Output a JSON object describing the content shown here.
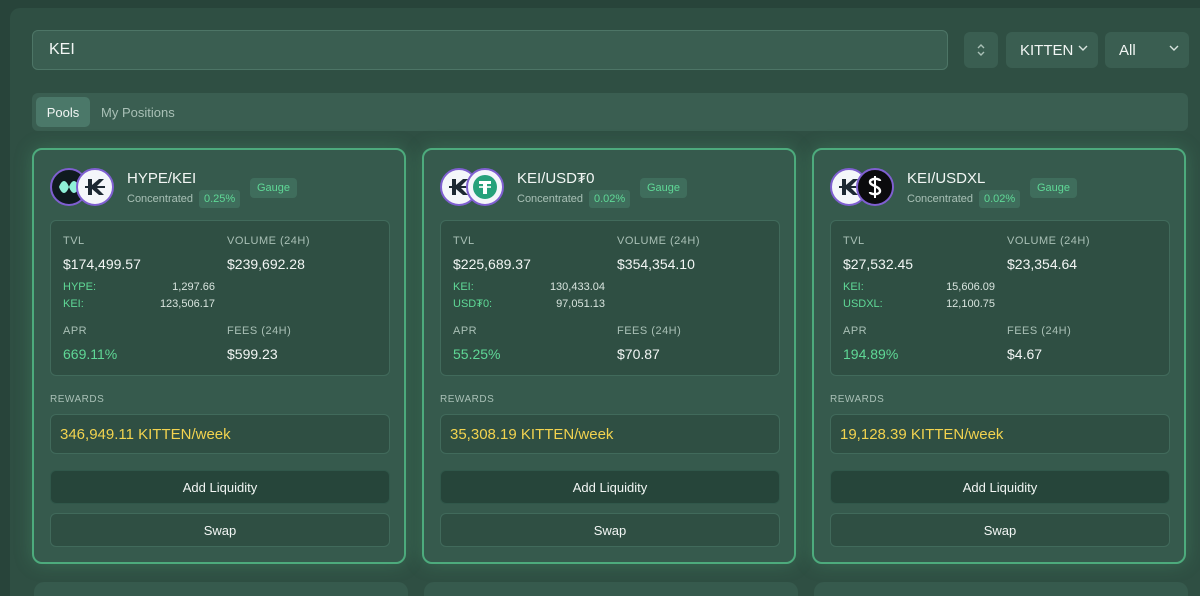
{
  "search": {
    "value": "KEI"
  },
  "filters": {
    "sort_icon": "sort-arrows-icon",
    "token": "KITTEN",
    "category": "All"
  },
  "tabs": [
    {
      "label": "Pools"
    },
    {
      "label": "My Positions"
    }
  ],
  "labels": {
    "tvl": "TVL",
    "volume": "VOLUME (24H)",
    "apr": "APR",
    "fees": "FEES (24H)",
    "rewards": "REWARDS",
    "add_liquidity": "Add Liquidity",
    "swap": "Swap"
  },
  "pools": [
    {
      "name": "HYPE/KEI",
      "type": "Concentrated",
      "fee": "0.25%",
      "gauge": "Gauge",
      "tvl": "$174,499.57",
      "volume": "$239,692.28",
      "token1": "HYPE:",
      "token1_amount": "1,297.66",
      "token2": "KEI:",
      "token2_amount": "123,506.17",
      "apr": "669.11%",
      "fees": "$599.23",
      "rewards": "346,949.11 KITTEN/week",
      "logo_a": "hype-logo-icon",
      "logo_b": "kei-logo-icon"
    },
    {
      "name": "KEI/USD₮0",
      "type": "Concentrated",
      "fee": "0.02%",
      "gauge": "Gauge",
      "tvl": "$225,689.37",
      "volume": "$354,354.10",
      "token1": "KEI:",
      "token1_amount": "130,433.04",
      "token2": "USD₮0:",
      "token2_amount": "97,051.13",
      "apr": "55.25%",
      "fees": "$70.87",
      "rewards": "35,308.19 KITTEN/week",
      "logo_a": "kei-logo-icon",
      "logo_b": "usdt0-logo-icon"
    },
    {
      "name": "KEI/USDXL",
      "type": "Concentrated",
      "fee": "0.02%",
      "gauge": "Gauge",
      "tvl": "$27,532.45",
      "volume": "$23,354.64",
      "token1": "KEI:",
      "token1_amount": "15,606.09",
      "token2": "USDXL:",
      "token2_amount": "12,100.75",
      "apr": "194.89%",
      "fees": "$4.67",
      "rewards": "19,128.39 KITTEN/week",
      "logo_a": "kei-logo-icon",
      "logo_b": "usdxl-logo-icon"
    }
  ],
  "colors": {
    "accent": "#5fd896",
    "rewards": "#f2d34f",
    "card_border": "#4dab7d",
    "background": "#28443a"
  }
}
